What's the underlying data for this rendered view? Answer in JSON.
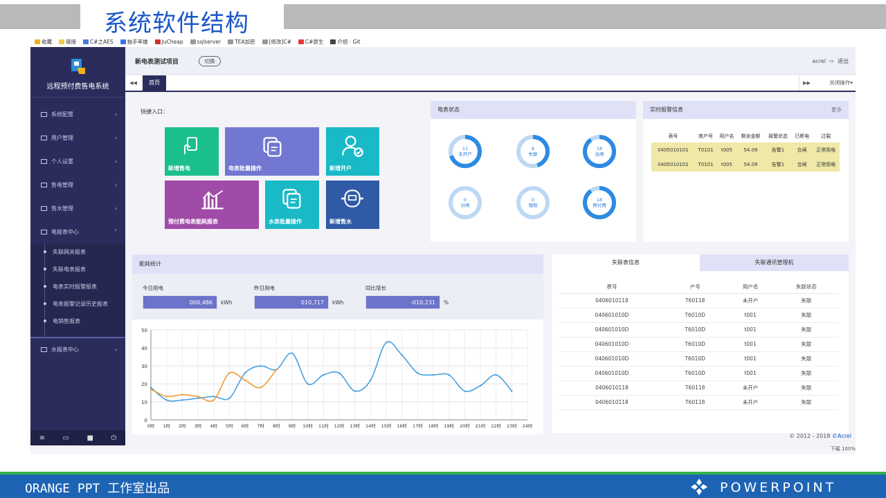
{
  "slide": {
    "title": "系统软件结构",
    "footer_left": "ORANGE PPT 工作室出品",
    "footer_right": "POWERPOINT"
  },
  "bookmarks": [
    "收藏",
    "链接",
    "C#之AES",
    "抽手率雄",
    "JuCheap",
    "sqlserver",
    "TEA加密",
    "[修改]C#",
    "C#原生",
    "介绍 · Git"
  ],
  "app": {
    "system_name": "远程预付费售电系统",
    "project_name": "新电表测试项目",
    "switch_label": "切换",
    "user": "acrel",
    "logout": "退出",
    "home_tab": "首页",
    "close_ops": "关闭操作"
  },
  "sidebar": {
    "items": [
      {
        "label": "系统配置"
      },
      {
        "label": "用户管理"
      },
      {
        "label": "个人设置"
      },
      {
        "label": "售电管理"
      },
      {
        "label": "售水管理"
      },
      {
        "label": "电报表中心"
      }
    ],
    "subitems": [
      "失联网关报表",
      "失联电表报表",
      "电表实时报警报表",
      "电表报警记录历史报表",
      "电销售报表"
    ],
    "last_item": "水报表中心"
  },
  "quick": {
    "label": "快捷入口：",
    "tiles": [
      {
        "label": "新增售电",
        "color": "#1bbf8e"
      },
      {
        "label": "电表批量操作",
        "color": "#7277d1"
      },
      {
        "label": "新增开户",
        "color": "#19b9c7"
      },
      {
        "label": "预付费电表能耗报表",
        "color": "#a04ba8"
      },
      {
        "label": "水表批量操作",
        "color": "#19b9c7"
      },
      {
        "label": "新增售水",
        "color": "#2f5aa6"
      }
    ]
  },
  "meter_status": {
    "title": "电表状态",
    "rings": [
      {
        "value": "11",
        "label": "未开户",
        "fill": 0.7
      },
      {
        "value": "8",
        "label": "失联",
        "fill": 0.45
      },
      {
        "value": "18",
        "label": "合闸",
        "fill": 0.9
      },
      {
        "value": "0",
        "label": "分闸",
        "fill": 0
      },
      {
        "value": "0",
        "label": "强制",
        "fill": 0
      },
      {
        "value": "18",
        "label": "预付费",
        "fill": 0.9
      }
    ]
  },
  "alarm": {
    "title": "实时报警信息",
    "more": "更多",
    "headers": [
      "表号",
      "商户号",
      "用户名",
      "剩余金额",
      "报警状态",
      "已断电",
      "过载"
    ],
    "rows": [
      [
        "0405010101",
        "T0101",
        "t005",
        "54.09",
        "告警1",
        "合闸",
        "正常用电"
      ],
      [
        "0405010101",
        "T0101",
        "t005",
        "54.09",
        "告警1",
        "合闸",
        "正常用电"
      ]
    ]
  },
  "energy": {
    "title": "能耗统计",
    "today_label": "今日用电",
    "today_value": "000,486",
    "today_unit": "kWh",
    "yesterday_label": "昨日用电",
    "yesterday_value": "010,717",
    "yesterday_unit": "kWh",
    "growth_label": "同比增长",
    "growth_value": "-010,231",
    "growth_unit": "%"
  },
  "chart_data": {
    "type": "line",
    "title": "",
    "xlabel": "",
    "ylabel": "",
    "ylim": [
      0,
      50
    ],
    "yticks": [
      0,
      10,
      20,
      30,
      40,
      50
    ],
    "categories": [
      "0时",
      "1时",
      "2时",
      "3时",
      "4时",
      "5时",
      "6时",
      "7时",
      "8时",
      "9时",
      "10时",
      "11时",
      "12时",
      "13时",
      "14时",
      "15时",
      "16时",
      "17时",
      "18时",
      "19时",
      "20时",
      "21时",
      "22时",
      "23时",
      "24时"
    ],
    "series": [
      {
        "color": "#3a9ae0",
        "values": [
          18,
          11,
          11,
          12,
          13,
          12,
          26,
          30,
          28,
          37,
          20,
          25,
          26,
          16,
          22,
          43,
          36,
          26,
          25,
          25,
          16,
          19,
          25,
          16
        ]
      },
      {
        "color": "#f0942c",
        "values": [
          17,
          13,
          14,
          13,
          11,
          26,
          22,
          18,
          28
        ]
      }
    ],
    "grid": true
  },
  "offline": {
    "tab1": "失联表信息",
    "tab2": "失联通讯管理机",
    "headers": [
      "表号",
      "户号",
      "用户名",
      "失联状态"
    ],
    "rows": [
      [
        "0406010118",
        "T60118",
        "未开户",
        "失联"
      ],
      [
        "040601010D",
        "T6010D",
        "t001",
        "失联"
      ],
      [
        "040601010D",
        "T6010D",
        "t001",
        "失联"
      ],
      [
        "040601010D",
        "T6010D",
        "t001",
        "失联"
      ],
      [
        "040601010D",
        "T6010D",
        "t001",
        "失联"
      ],
      [
        "040601010D",
        "T6010D",
        "t001",
        "失联"
      ],
      [
        "0406010118",
        "T60118",
        "未开户",
        "失联"
      ],
      [
        "0406010118",
        "T60118",
        "未开户",
        "失联"
      ]
    ]
  },
  "footer": {
    "copyright": "© 2012 - 2018",
    "brand": "©Acrel"
  },
  "statusbar": "下载   100%"
}
